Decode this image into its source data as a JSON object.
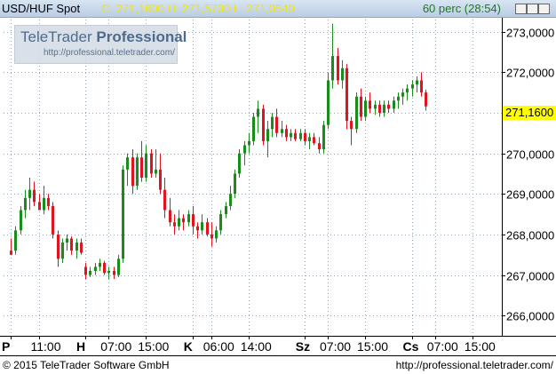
{
  "header": {
    "symbol": "USD/HUF Spot",
    "stats": "C: 271,1600 H: 271,5730 L: 271,0540",
    "period": "60 perc (28:54)"
  },
  "logo": {
    "name_regular": "TeleTrader ",
    "name_bold": "Professional",
    "url": "http://professional.teletrader.com/"
  },
  "footer": {
    "copyright": "© 2015 TeleTrader Software GmbH",
    "url": "http://professional.teletrader.com/"
  },
  "last_price_label": "271,1600",
  "colors": {
    "up": "#1a8c1a",
    "down": "#e0141e",
    "grid": "#9aa6b4",
    "last_price_bg": "#ffff00",
    "header_stats": "#f2e600",
    "header_period": "#1f7a1f"
  },
  "chart_data": {
    "type": "candlestick",
    "ylim": [
      265.5,
      273.3
    ],
    "y_ticks": [
      "266,0000",
      "267,0000",
      "268,0000",
      "269,0000",
      "270,0000",
      "271,0000",
      "272,0000",
      "273,0000"
    ],
    "y_tick_values": [
      266,
      267,
      268,
      269,
      270,
      271,
      272,
      273
    ],
    "x_ticks": [
      {
        "label": "P",
        "bold": true,
        "index": 0
      },
      {
        "label": "11:00",
        "bold": false,
        "index": 6
      },
      {
        "label": "H",
        "bold": true,
        "index": 16
      },
      {
        "label": "07:00",
        "bold": false,
        "index": 21
      },
      {
        "label": "15:00",
        "bold": false,
        "index": 29
      },
      {
        "label": "K",
        "bold": true,
        "index": 39
      },
      {
        "label": "06:00",
        "bold": false,
        "index": 43
      },
      {
        "label": "14:00",
        "bold": false,
        "index": 51
      },
      {
        "label": "Sz",
        "bold": true,
        "index": 63
      },
      {
        "label": "07:00",
        "bold": false,
        "index": 68
      },
      {
        "label": "15:00",
        "bold": false,
        "index": 76
      },
      {
        "label": "Cs",
        "bold": true,
        "index": 86
      },
      {
        "label": "07:00",
        "bold": false,
        "index": 91
      },
      {
        "label": "15:00",
        "bold": false,
        "index": 99
      }
    ],
    "candles": [
      {
        "o": 267.6,
        "h": 267.9,
        "l": 267.5,
        "c": 267.5
      },
      {
        "o": 267.6,
        "h": 268.2,
        "l": 267.5,
        "c": 268.1
      },
      {
        "o": 268.1,
        "h": 268.7,
        "l": 268.0,
        "c": 268.6
      },
      {
        "o": 268.6,
        "h": 269.1,
        "l": 268.4,
        "c": 268.9
      },
      {
        "o": 268.9,
        "h": 269.4,
        "l": 268.6,
        "c": 269.1
      },
      {
        "o": 269.1,
        "h": 269.3,
        "l": 268.7,
        "c": 268.8
      },
      {
        "o": 268.8,
        "h": 269.0,
        "l": 268.6,
        "c": 268.6
      },
      {
        "o": 268.6,
        "h": 269.2,
        "l": 268.5,
        "c": 268.9
      },
      {
        "o": 268.9,
        "h": 269.0,
        "l": 268.6,
        "c": 268.7
      },
      {
        "o": 268.7,
        "h": 268.8,
        "l": 267.9,
        "c": 268.0
      },
      {
        "o": 268.0,
        "h": 268.1,
        "l": 267.2,
        "c": 267.4
      },
      {
        "o": 267.4,
        "h": 267.9,
        "l": 267.3,
        "c": 267.8
      },
      {
        "o": 267.8,
        "h": 268.0,
        "l": 267.6,
        "c": 267.9
      },
      {
        "o": 267.9,
        "h": 267.95,
        "l": 267.5,
        "c": 267.6
      },
      {
        "o": 267.6,
        "h": 267.9,
        "l": 267.4,
        "c": 267.8
      },
      {
        "o": 267.8,
        "h": 267.9,
        "l": 267.5,
        "c": 267.55
      },
      {
        "o": 267.2,
        "h": 267.3,
        "l": 266.9,
        "c": 267.0
      },
      {
        "o": 267.0,
        "h": 267.2,
        "l": 266.95,
        "c": 267.1
      },
      {
        "o": 267.1,
        "h": 267.3,
        "l": 267.0,
        "c": 267.2
      },
      {
        "o": 267.2,
        "h": 267.4,
        "l": 267.1,
        "c": 267.3
      },
      {
        "o": 267.3,
        "h": 267.35,
        "l": 267.0,
        "c": 267.05
      },
      {
        "o": 267.05,
        "h": 267.2,
        "l": 266.9,
        "c": 267.1
      },
      {
        "o": 267.1,
        "h": 267.2,
        "l": 266.9,
        "c": 267.0
      },
      {
        "o": 267.0,
        "h": 267.5,
        "l": 266.95,
        "c": 267.4
      },
      {
        "o": 267.4,
        "h": 269.7,
        "l": 267.3,
        "c": 269.6
      },
      {
        "o": 269.6,
        "h": 270.0,
        "l": 269.2,
        "c": 269.9
      },
      {
        "o": 269.9,
        "h": 270.1,
        "l": 269.0,
        "c": 269.2
      },
      {
        "o": 269.2,
        "h": 270.0,
        "l": 269.1,
        "c": 269.9
      },
      {
        "o": 269.9,
        "h": 270.3,
        "l": 269.3,
        "c": 269.4
      },
      {
        "o": 269.4,
        "h": 270.2,
        "l": 269.3,
        "c": 270.0
      },
      {
        "o": 270.0,
        "h": 270.1,
        "l": 269.4,
        "c": 269.5
      },
      {
        "o": 269.5,
        "h": 270.1,
        "l": 269.4,
        "c": 269.6
      },
      {
        "o": 269.6,
        "h": 270.0,
        "l": 269.0,
        "c": 269.1
      },
      {
        "o": 269.1,
        "h": 269.4,
        "l": 268.4,
        "c": 268.6
      },
      {
        "o": 268.6,
        "h": 268.9,
        "l": 268.2,
        "c": 268.3
      },
      {
        "o": 268.3,
        "h": 268.5,
        "l": 268.0,
        "c": 268.2
      },
      {
        "o": 268.2,
        "h": 268.6,
        "l": 268.1,
        "c": 268.4
      },
      {
        "o": 268.4,
        "h": 268.5,
        "l": 268.1,
        "c": 268.3
      },
      {
        "o": 268.3,
        "h": 268.6,
        "l": 268.2,
        "c": 268.5
      },
      {
        "o": 268.5,
        "h": 268.7,
        "l": 268.0,
        "c": 268.2
      },
      {
        "o": 268.2,
        "h": 268.3,
        "l": 267.9,
        "c": 268.1
      },
      {
        "o": 268.1,
        "h": 268.5,
        "l": 268.0,
        "c": 268.3
      },
      {
        "o": 268.3,
        "h": 268.4,
        "l": 267.95,
        "c": 268.0
      },
      {
        "o": 268.0,
        "h": 268.3,
        "l": 267.7,
        "c": 267.9
      },
      {
        "o": 267.9,
        "h": 268.2,
        "l": 267.8,
        "c": 268.1
      },
      {
        "o": 268.1,
        "h": 268.6,
        "l": 268.0,
        "c": 268.5
      },
      {
        "o": 268.5,
        "h": 268.8,
        "l": 268.4,
        "c": 268.7
      },
      {
        "o": 268.7,
        "h": 269.2,
        "l": 268.6,
        "c": 269.0
      },
      {
        "o": 269.0,
        "h": 269.6,
        "l": 268.9,
        "c": 269.5
      },
      {
        "o": 269.5,
        "h": 270.1,
        "l": 269.4,
        "c": 270.0
      },
      {
        "o": 270.0,
        "h": 270.3,
        "l": 269.7,
        "c": 270.2
      },
      {
        "o": 270.2,
        "h": 270.5,
        "l": 270.0,
        "c": 270.3
      },
      {
        "o": 270.3,
        "h": 271.0,
        "l": 270.2,
        "c": 270.9
      },
      {
        "o": 270.9,
        "h": 271.3,
        "l": 270.5,
        "c": 271.1
      },
      {
        "o": 271.1,
        "h": 271.2,
        "l": 270.2,
        "c": 270.3
      },
      {
        "o": 270.3,
        "h": 270.8,
        "l": 269.9,
        "c": 270.6
      },
      {
        "o": 270.6,
        "h": 271.0,
        "l": 270.4,
        "c": 270.9
      },
      {
        "o": 270.9,
        "h": 271.1,
        "l": 270.4,
        "c": 270.5
      },
      {
        "o": 270.5,
        "h": 270.8,
        "l": 270.4,
        "c": 270.6
      },
      {
        "o": 270.6,
        "h": 270.7,
        "l": 270.3,
        "c": 270.4
      },
      {
        "o": 270.4,
        "h": 270.6,
        "l": 270.3,
        "c": 270.5
      },
      {
        "o": 270.5,
        "h": 270.6,
        "l": 270.3,
        "c": 270.35
      },
      {
        "o": 270.35,
        "h": 270.6,
        "l": 270.3,
        "c": 270.5
      },
      {
        "o": 270.5,
        "h": 270.6,
        "l": 270.2,
        "c": 270.3
      },
      {
        "o": 270.3,
        "h": 270.5,
        "l": 270.1,
        "c": 270.4
      },
      {
        "o": 270.4,
        "h": 270.5,
        "l": 270.2,
        "c": 270.25
      },
      {
        "o": 270.25,
        "h": 270.4,
        "l": 270.0,
        "c": 270.1
      },
      {
        "o": 270.1,
        "h": 270.8,
        "l": 270.0,
        "c": 270.7
      },
      {
        "o": 270.7,
        "h": 272.0,
        "l": 270.6,
        "c": 271.8
      },
      {
        "o": 271.8,
        "h": 273.2,
        "l": 271.6,
        "c": 272.4
      },
      {
        "o": 272.4,
        "h": 272.6,
        "l": 271.7,
        "c": 271.8
      },
      {
        "o": 271.8,
        "h": 272.3,
        "l": 271.6,
        "c": 272.1
      },
      {
        "o": 272.1,
        "h": 272.2,
        "l": 270.6,
        "c": 270.8
      },
      {
        "o": 270.8,
        "h": 270.9,
        "l": 270.2,
        "c": 270.6
      },
      {
        "o": 270.6,
        "h": 271.5,
        "l": 270.5,
        "c": 271.4
      },
      {
        "o": 271.4,
        "h": 271.6,
        "l": 270.8,
        "c": 270.9
      },
      {
        "o": 270.9,
        "h": 271.4,
        "l": 270.8,
        "c": 271.3
      },
      {
        "o": 271.3,
        "h": 271.5,
        "l": 271.0,
        "c": 271.1
      },
      {
        "o": 271.1,
        "h": 271.3,
        "l": 270.95,
        "c": 271.2
      },
      {
        "o": 271.2,
        "h": 271.3,
        "l": 270.9,
        "c": 271.0
      },
      {
        "o": 271.0,
        "h": 271.3,
        "l": 270.9,
        "c": 271.2
      },
      {
        "o": 271.2,
        "h": 271.3,
        "l": 271.0,
        "c": 271.1
      },
      {
        "o": 271.1,
        "h": 271.4,
        "l": 271.0,
        "c": 271.3
      },
      {
        "o": 271.3,
        "h": 271.5,
        "l": 271.1,
        "c": 271.4
      },
      {
        "o": 271.4,
        "h": 271.6,
        "l": 271.2,
        "c": 271.5
      },
      {
        "o": 271.5,
        "h": 271.7,
        "l": 271.3,
        "c": 271.6
      },
      {
        "o": 271.6,
        "h": 271.8,
        "l": 271.4,
        "c": 271.7
      },
      {
        "o": 271.7,
        "h": 271.9,
        "l": 271.5,
        "c": 271.8
      },
      {
        "o": 271.8,
        "h": 272.0,
        "l": 271.4,
        "c": 271.5
      },
      {
        "o": 271.5,
        "h": 271.573,
        "l": 271.054,
        "c": 271.16
      }
    ]
  }
}
